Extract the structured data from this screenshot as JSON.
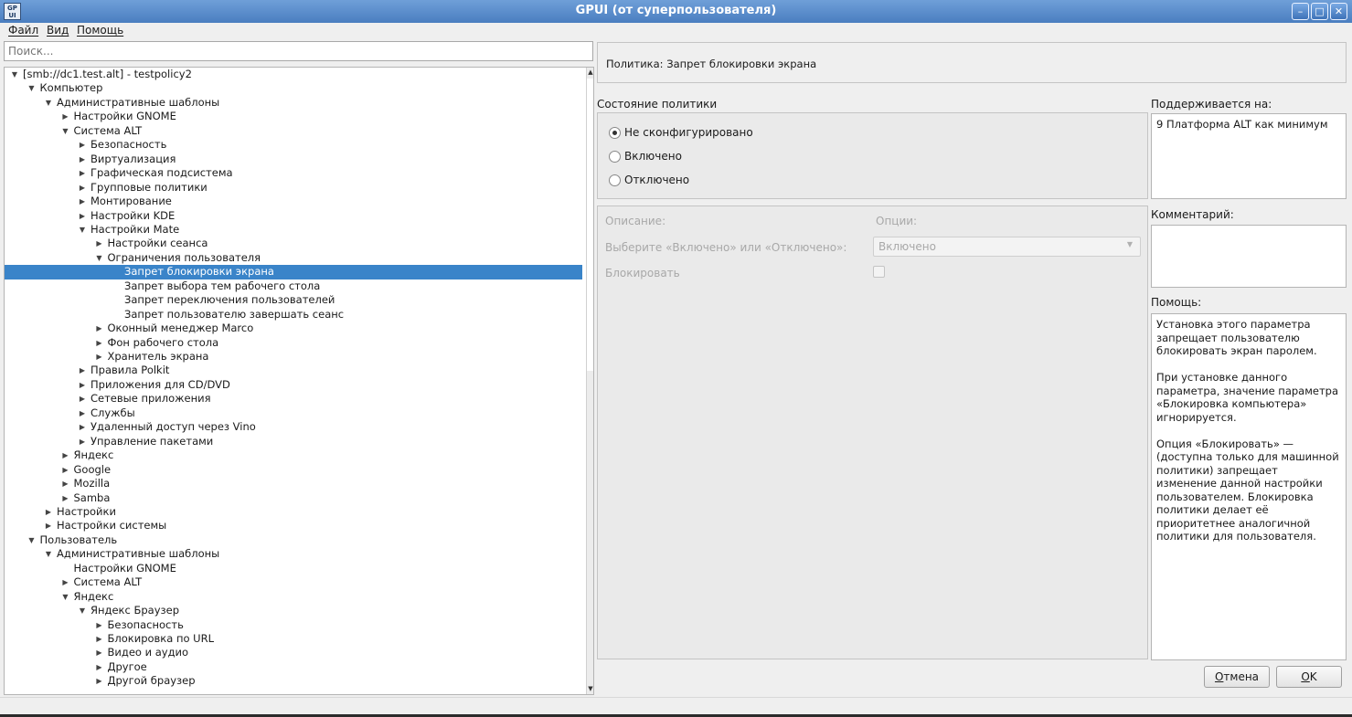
{
  "window": {
    "title": "GPUI (от суперпользователя)",
    "app_icon_text": "GP\nUI",
    "min_glyph": "–",
    "max_glyph": "□",
    "close_glyph": "✕"
  },
  "menu": {
    "file": "Файл",
    "view": "Вид",
    "help": "Помощь"
  },
  "search": {
    "placeholder": "Поиск...",
    "value": ""
  },
  "tree": {
    "items": [
      {
        "label": "[smb://dc1.test.alt] - testpolicy2",
        "level": 0,
        "arrow": "open"
      },
      {
        "label": "Компьютер",
        "level": 1,
        "arrow": "open"
      },
      {
        "label": "Административные шаблоны",
        "level": 2,
        "arrow": "open"
      },
      {
        "label": "Настройки GNOME",
        "level": 3,
        "arrow": "closed"
      },
      {
        "label": "Система ALT",
        "level": 3,
        "arrow": "open"
      },
      {
        "label": "Безопасность",
        "level": 4,
        "arrow": "closed"
      },
      {
        "label": "Виртуализация",
        "level": 4,
        "arrow": "closed"
      },
      {
        "label": "Графическая подсистема",
        "level": 4,
        "arrow": "closed"
      },
      {
        "label": "Групповые политики",
        "level": 4,
        "arrow": "closed"
      },
      {
        "label": "Монтирование",
        "level": 4,
        "arrow": "closed"
      },
      {
        "label": "Настройки KDE",
        "level": 4,
        "arrow": "closed"
      },
      {
        "label": "Настройки Mate",
        "level": 4,
        "arrow": "open"
      },
      {
        "label": "Настройки сеанса",
        "level": 5,
        "arrow": "closed"
      },
      {
        "label": "Ограничения пользователя",
        "level": 5,
        "arrow": "open"
      },
      {
        "label": "Запрет блокировки экрана",
        "level": 6,
        "arrow": "none",
        "selected": true
      },
      {
        "label": "Запрет выбора тем рабочего стола",
        "level": 6,
        "arrow": "none"
      },
      {
        "label": "Запрет переключения пользователей",
        "level": 6,
        "arrow": "none"
      },
      {
        "label": "Запрет пользователю завершать сеанс",
        "level": 6,
        "arrow": "none"
      },
      {
        "label": "Оконный менеджер Marco",
        "level": 5,
        "arrow": "closed"
      },
      {
        "label": "Фон рабочего стола",
        "level": 5,
        "arrow": "closed"
      },
      {
        "label": "Хранитель экрана",
        "level": 5,
        "arrow": "closed"
      },
      {
        "label": "Правила Polkit",
        "level": 4,
        "arrow": "closed"
      },
      {
        "label": "Приложения для CD/DVD",
        "level": 4,
        "arrow": "closed"
      },
      {
        "label": "Сетевые приложения",
        "level": 4,
        "arrow": "closed"
      },
      {
        "label": "Службы",
        "level": 4,
        "arrow": "closed"
      },
      {
        "label": "Удаленный доступ через Vino",
        "level": 4,
        "arrow": "closed"
      },
      {
        "label": "Управление пакетами",
        "level": 4,
        "arrow": "closed"
      },
      {
        "label": "Яндекс",
        "level": 3,
        "arrow": "closed"
      },
      {
        "label": "Google",
        "level": 3,
        "arrow": "closed"
      },
      {
        "label": "Mozilla",
        "level": 3,
        "arrow": "closed"
      },
      {
        "label": "Samba",
        "level": 3,
        "arrow": "closed"
      },
      {
        "label": "Настройки",
        "level": 2,
        "arrow": "closed"
      },
      {
        "label": "Настройки системы",
        "level": 2,
        "arrow": "closed"
      },
      {
        "label": "Пользователь",
        "level": 1,
        "arrow": "open"
      },
      {
        "label": "Административные шаблоны",
        "level": 2,
        "arrow": "open"
      },
      {
        "label": "Настройки GNOME",
        "level": 3,
        "arrow": "none"
      },
      {
        "label": "Система ALT",
        "level": 3,
        "arrow": "closed"
      },
      {
        "label": "Яндекс",
        "level": 3,
        "arrow": "open"
      },
      {
        "label": "Яндекс Браузер",
        "level": 4,
        "arrow": "open"
      },
      {
        "label": "Безопасность",
        "level": 5,
        "arrow": "closed"
      },
      {
        "label": "Блокировка по URL",
        "level": 5,
        "arrow": "closed"
      },
      {
        "label": "Видео и аудио",
        "level": 5,
        "arrow": "closed"
      },
      {
        "label": "Другое",
        "level": 5,
        "arrow": "closed"
      },
      {
        "label": "Другой браузер",
        "level": 5,
        "arrow": "closed"
      }
    ]
  },
  "policy": {
    "title": "Политика: Запрет блокировки экрана",
    "state_label": "Состояние политики",
    "states": [
      {
        "label": "Не сконфигурировано",
        "checked": true
      },
      {
        "label": "Включено",
        "checked": false
      },
      {
        "label": "Отключено",
        "checked": false
      }
    ],
    "description_label": "Описание:",
    "options_label": "Опции:",
    "choose_label": "Выберите «Включено» или «Отключено»:",
    "choose_value": "Включено",
    "lock_label": "Блокировать"
  },
  "side": {
    "supported_label": "Поддерживается на:",
    "supported_value": "9 Платформа ALT как минимум",
    "comment_label": "Комментарий:",
    "comment_value": "",
    "help_label": "Помощь:",
    "help_paragraphs": [
      "Установка этого параметра запрещает пользователю блокировать экран паролем.",
      "При установке данного параметра, значение параметра «Блокировка компьютера» игнорируется.",
      "Опция «Блокировать» — (доступна только для машинной политики) запрещает изменение данной настройки пользователем. Блокировка политики делает её приоритетнее аналогичной политики для пользователя."
    ]
  },
  "buttons": {
    "cancel_pre": "",
    "cancel_underlined": "О",
    "cancel_post": "тмена",
    "ok_pre": "",
    "ok_underlined": "O",
    "ok_post": "K"
  }
}
